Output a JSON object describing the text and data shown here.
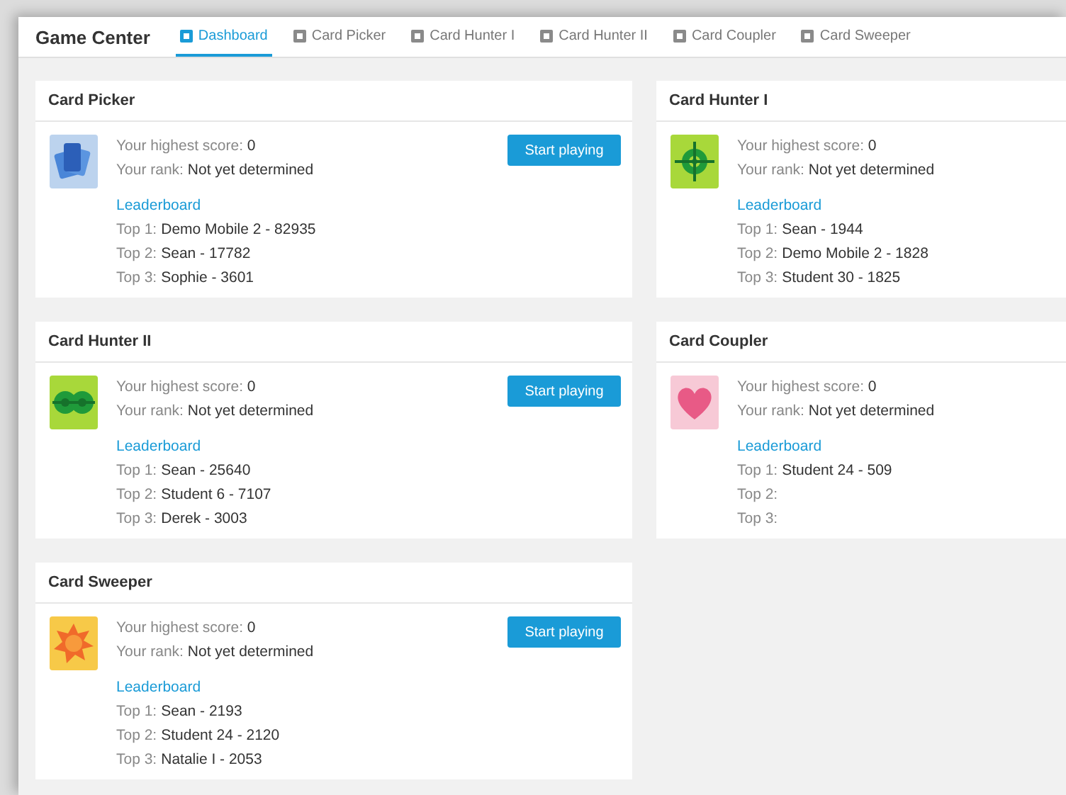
{
  "app": {
    "title": "Game Center"
  },
  "tabs": [
    {
      "label": "Dashboard",
      "selected": true
    },
    {
      "label": "Card Picker",
      "selected": false
    },
    {
      "label": "Card Hunter I",
      "selected": false
    },
    {
      "label": "Card Hunter II",
      "selected": false
    },
    {
      "label": "Card Coupler",
      "selected": false
    },
    {
      "label": "Card Sweeper",
      "selected": false
    }
  ],
  "columns": [
    {
      "games": [
        {
          "title": "Card Picker",
          "kind": "cards",
          "button": "Start playing",
          "score_label": "Your highest score:",
          "score": "0",
          "rank_label": "Your rank:",
          "rank": "Not yet determined",
          "leaderboard": "Leaderboard",
          "top": [
            {
              "label": "Top 1:",
              "value": "Demo Mobile 2 - 82935"
            },
            {
              "label": "Top 2:",
              "value": "Sean - 17782"
            },
            {
              "label": "Top 3:",
              "value": "Sophie - 3601"
            }
          ]
        },
        {
          "title": "Card Hunter II",
          "kind": "double-target",
          "button": "Start playing",
          "score_label": "Your highest score:",
          "score": "0",
          "rank_label": "Your rank:",
          "rank": "Not yet determined",
          "leaderboard": "Leaderboard",
          "top": [
            {
              "label": "Top 1:",
              "value": "Sean - 25640"
            },
            {
              "label": "Top 2:",
              "value": "Student 6 - 7107"
            },
            {
              "label": "Top 3:",
              "value": "Derek - 3003"
            }
          ]
        },
        {
          "title": "Card Sweeper",
          "kind": "sun",
          "button": "Start playing",
          "score_label": "Your highest score:",
          "score": "0",
          "rank_label": "Your rank:",
          "rank": "Not yet determined",
          "leaderboard": "Leaderboard",
          "top": [
            {
              "label": "Top 1:",
              "value": "Sean - 2193"
            },
            {
              "label": "Top 2:",
              "value": "Student 24 - 2120"
            },
            {
              "label": "Top 3:",
              "value": "Natalie I - 2053"
            }
          ]
        }
      ]
    },
    {
      "games": [
        {
          "title": "Card Hunter I",
          "kind": "target",
          "score_label": "Your highest score:",
          "score": "0",
          "rank_label": "Your rank:",
          "rank": "Not yet determined",
          "leaderboard": "Leaderboard",
          "top": [
            {
              "label": "Top 1:",
              "value": "Sean - 1944"
            },
            {
              "label": "Top 2:",
              "value": "Demo Mobile 2 - 1828"
            },
            {
              "label": "Top 3:",
              "value": "Student 30 - 1825"
            }
          ]
        },
        {
          "title": "Card Coupler",
          "kind": "heart",
          "score_label": "Your highest score:",
          "score": "0",
          "rank_label": "Your rank:",
          "rank": "Not yet determined",
          "leaderboard": "Leaderboard",
          "top": [
            {
              "label": "Top 1:",
              "value": "Student 24 - 509"
            },
            {
              "label": "Top 2:"
            },
            {
              "label": "Top 3:"
            }
          ]
        }
      ]
    }
  ]
}
